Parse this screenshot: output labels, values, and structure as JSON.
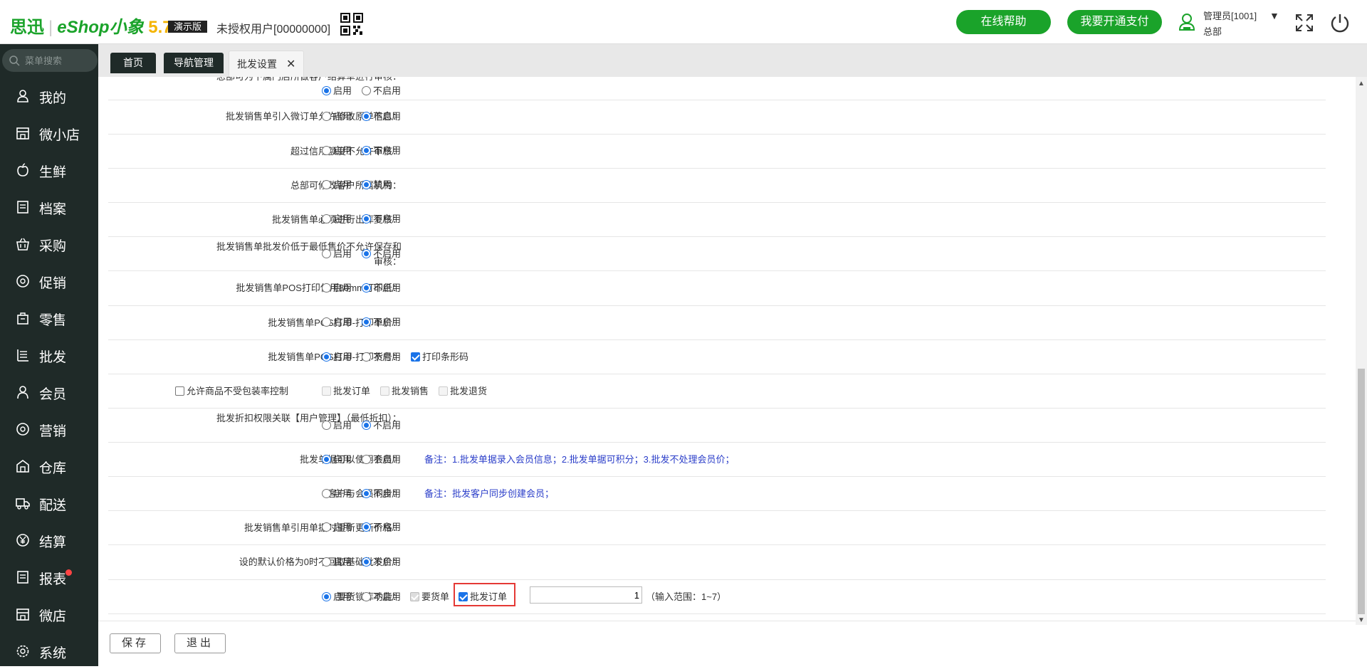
{
  "header": {
    "logo_cn": "思迅",
    "logo_eshop": "eShop小象",
    "logo_ver": "5.7",
    "demo_badge": "演示版",
    "unauth_user": "未授权用户[00000000]",
    "help_button": "在线帮助",
    "pay_button": "我要开通支付",
    "user_name": "管理员[1001]",
    "user_dept": "总部"
  },
  "sidebar": {
    "search_placeholder": "菜单搜索",
    "items": [
      {
        "label": "我的",
        "icon": "user-icon"
      },
      {
        "label": "微小店",
        "icon": "store-icon"
      },
      {
        "label": "生鲜",
        "icon": "apple-icon"
      },
      {
        "label": "档案",
        "icon": "file-icon"
      },
      {
        "label": "采购",
        "icon": "basket-icon"
      },
      {
        "label": "促销",
        "icon": "promo-icon"
      },
      {
        "label": "零售",
        "icon": "bag-icon"
      },
      {
        "label": "批发",
        "icon": "wholesale-icon"
      },
      {
        "label": "会员",
        "icon": "member-icon"
      },
      {
        "label": "营销",
        "icon": "marketing-icon"
      },
      {
        "label": "仓库",
        "icon": "warehouse-icon"
      },
      {
        "label": "配送",
        "icon": "truck-icon"
      },
      {
        "label": "结算",
        "icon": "yen-icon"
      },
      {
        "label": "报表",
        "icon": "report-icon"
      },
      {
        "label": "微店",
        "icon": "shop-icon"
      },
      {
        "label": "系统",
        "icon": "settings-icon"
      }
    ]
  },
  "tabs": {
    "home": "首页",
    "nav": "导航管理",
    "active": "批发设置"
  },
  "settings": {
    "r0": {
      "label": "总部可为下属门店所做客户结算单进行审核：",
      "on": "启用",
      "off": "不启用"
    },
    "r1": {
      "label": "批发销售单引入微订单允许修改原单信息：",
      "on": "启用",
      "off": "不启用"
    },
    "r2": {
      "label": "超过信用额度不允许审核：",
      "on": "启用",
      "off": "不启用"
    },
    "r3": {
      "label": "总部可修改客户所属机构：",
      "on": "启用",
      "off": "禁用"
    },
    "r4": {
      "label": "批发销售单必须进行出库复核：",
      "on": "启用",
      "off": "不启用"
    },
    "r5": {
      "label": "批发销售单批发价低于最低售价不允许保存和审核：",
      "on": "启用",
      "off": "不启用"
    },
    "r6": {
      "label": "批发销售单POS打印使用80mm打印纸：",
      "on": "启用",
      "off": "不启用"
    },
    "r7": {
      "label": "批发销售单POS打印-打印单价：",
      "on": "启用",
      "off": "不启用"
    },
    "r8": {
      "label": "批发销售单POS打印-打印货号：",
      "on": "启用",
      "off": "不启用",
      "extra": "打印条形码"
    },
    "r9": {
      "label": "允许商品不受包装率控制",
      "c1": "批发订单",
      "c2": "批发销售",
      "c3": "批发退货"
    },
    "r10": {
      "label": "批发折扣权限关联【用户管理】（最低折扣）：",
      "on": "启用",
      "off": "不启用"
    },
    "r11": {
      "label": "批发单据可以使用会员：",
      "on": "启用",
      "off": "不启用",
      "note": "备注：1.批发单据录入会员信息；2.批发单据可积分；3.批发不处理会员价；"
    },
    "r12": {
      "label": "客户与会员同步：",
      "on": "启用",
      "off": "不启用",
      "note": "备注：批发客户同步创建会员；"
    },
    "r13": {
      "label": "批发销售单引用单据时重新更新价格：",
      "on": "启用",
      "off": "不启用"
    },
    "r14": {
      "label": "设的默认价格为0时不回取基础批发价：",
      "on": "启用",
      "off": "不启用"
    },
    "r15": {
      "label": "要货锁库功能：",
      "on": "启用",
      "off": "不启用",
      "c1": "要货单",
      "c2": "批发订单",
      "value": "1",
      "range": "（输入范围：1~7）"
    }
  },
  "footer": {
    "save": "保存",
    "exit": "退出"
  },
  "colors": {
    "brand_green": "#1aa32a",
    "sidebar_bg": "#1f2a28",
    "note_blue": "#2b3ec9",
    "radio_blue": "#1a73e8",
    "highlight_red": "#e53935"
  }
}
